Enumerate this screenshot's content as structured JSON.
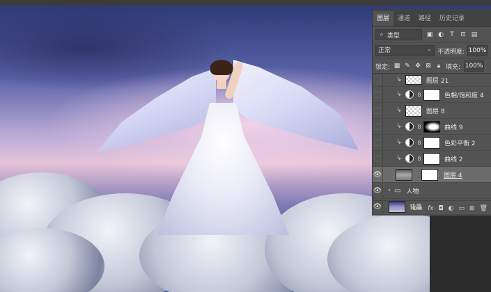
{
  "panel": {
    "tabs": [
      "图层",
      "通道",
      "路径",
      "历史记录"
    ],
    "filter": {
      "label": "类型"
    },
    "blend_mode": "正常",
    "opacity": {
      "label": "不透明度:",
      "value": "100%"
    },
    "lock": {
      "label": "锁定:"
    },
    "fill": {
      "label": "填充:",
      "value": "100%"
    },
    "layers": [
      {
        "name": "图层 21",
        "visible": false,
        "clipped": true,
        "thumb": "checker"
      },
      {
        "name": "色相/饱和度 4",
        "visible": false,
        "clipped": true,
        "thumb": "white",
        "adjustment": true
      },
      {
        "name": "图层 8",
        "visible": false,
        "clipped": true,
        "thumb": "checker"
      },
      {
        "name": "曲线 9",
        "visible": false,
        "clipped": true,
        "thumb": "dark",
        "adjustment": true
      },
      {
        "name": "色彩平衡 2",
        "visible": false,
        "clipped": true,
        "thumb": "white",
        "adjustment": true
      },
      {
        "name": "曲线 2",
        "visible": false,
        "clipped": true,
        "thumb": "white",
        "adjustment": true
      },
      {
        "name": "图层 4",
        "visible": true,
        "selected": true,
        "thumb": "photo"
      },
      {
        "name": "人物",
        "visible": true,
        "group": true
      },
      {
        "name": "背景",
        "visible": true,
        "thumb": "bg"
      }
    ],
    "bottom_icons": [
      "link-icon",
      "fx-icon",
      "mask-icon",
      "adjustment-icon",
      "folder-icon",
      "new-layer-icon",
      "trash-icon"
    ],
    "bottom_labels": {
      "link": "⊖⊖",
      "fx": "fx"
    }
  },
  "colors": {
    "panel_bg": "#535353",
    "selected": "#6c6c6c"
  }
}
